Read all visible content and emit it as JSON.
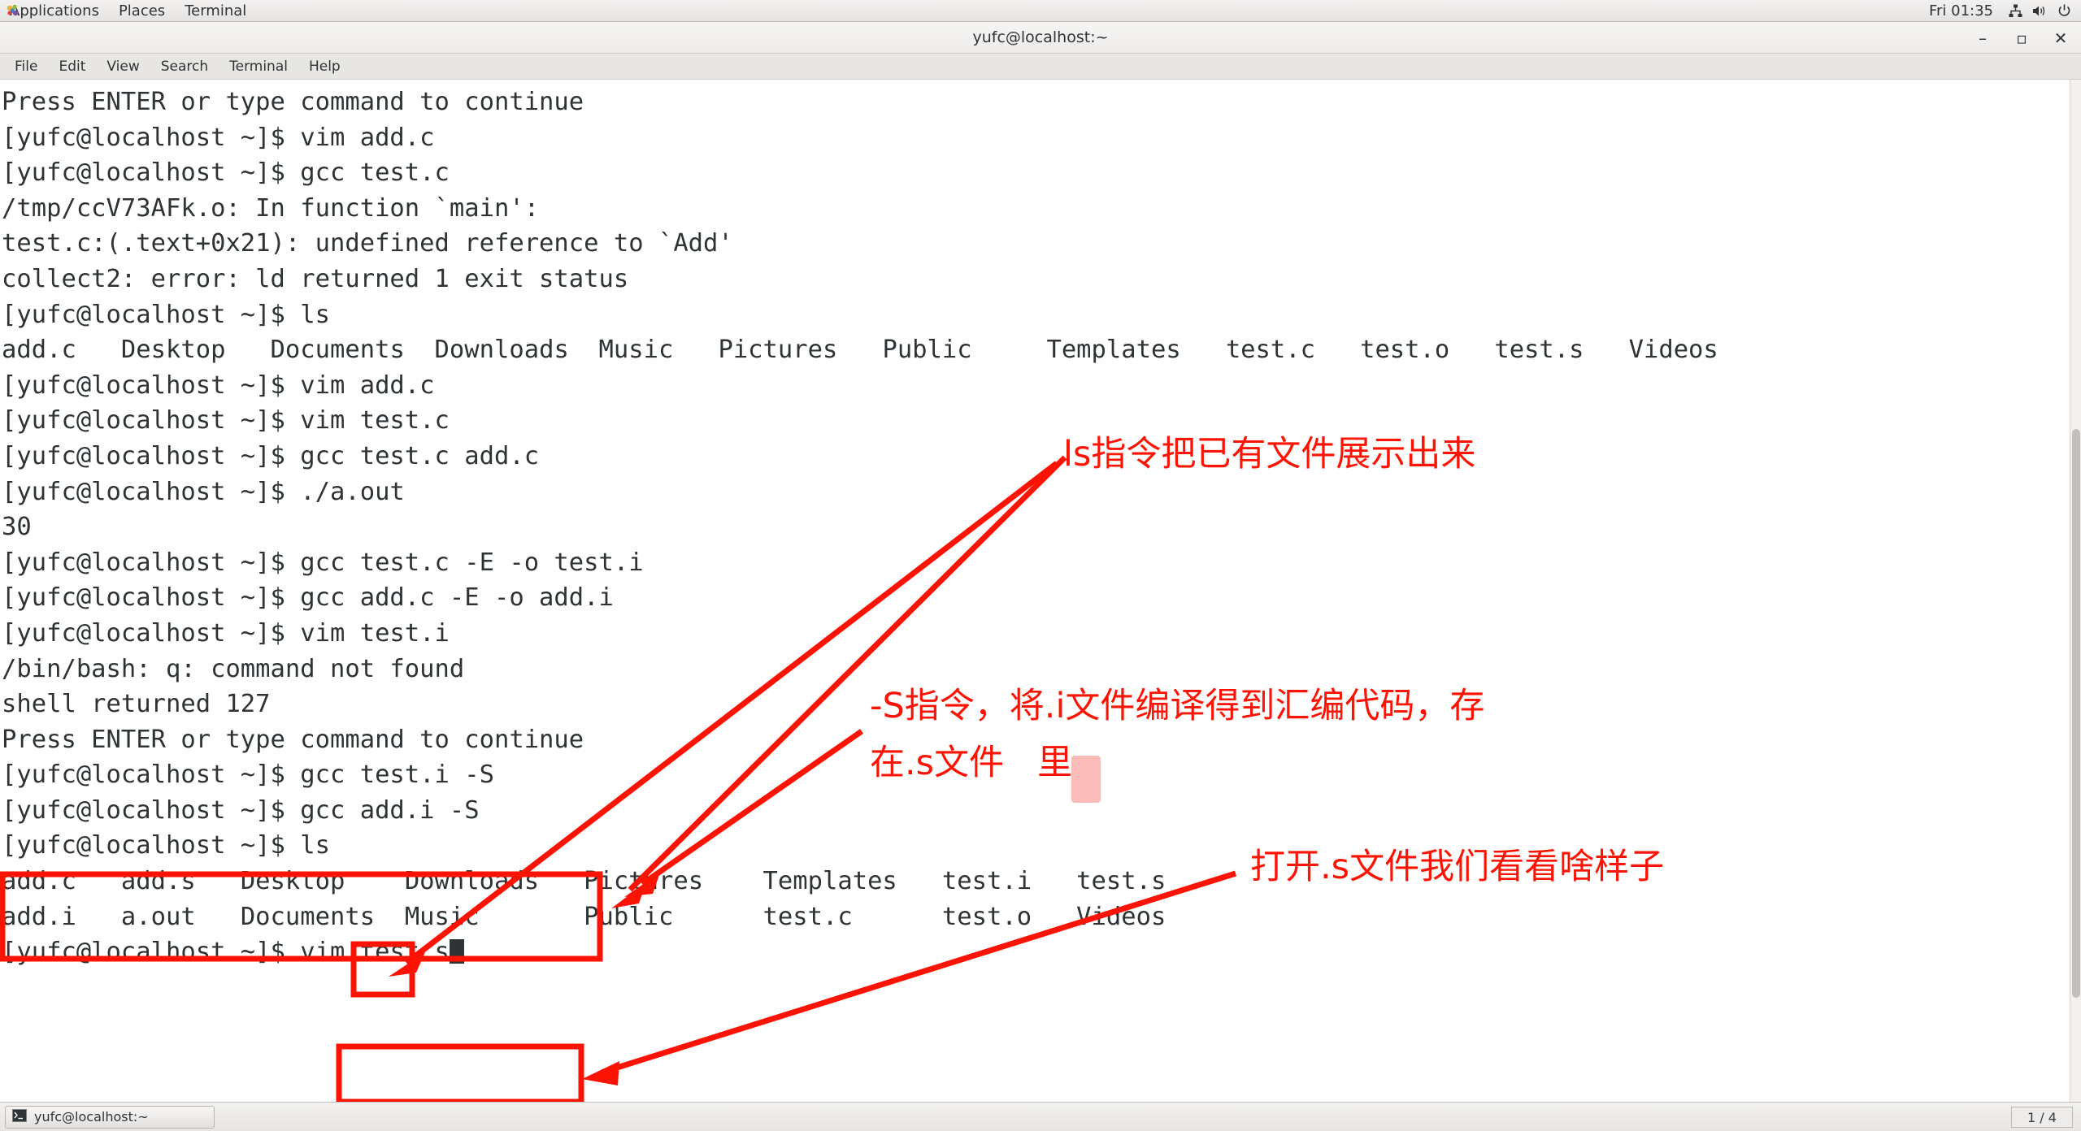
{
  "top_panel": {
    "menus": [
      "Applications",
      "Places",
      "Terminal"
    ],
    "clock": "Fri 01:35",
    "tray": [
      "network-icon",
      "volume-icon",
      "power-icon"
    ],
    "apps_icon": "gnome-footprint-icon"
  },
  "window": {
    "title": "yufc@localhost:~",
    "buttons": {
      "minimize": "–",
      "maximize": "▫",
      "close": "✕"
    },
    "menubar": [
      "File",
      "Edit",
      "View",
      "Search",
      "Terminal",
      "Help"
    ]
  },
  "terminal": {
    "prompt": "[yufc@localhost ~]$ ",
    "lines": [
      {
        "id": "l0",
        "type": "plain",
        "text": "Press ENTER or type command to continue"
      },
      {
        "id": "l1",
        "type": "cmd",
        "text": "vim add.c"
      },
      {
        "id": "l2",
        "type": "cmd",
        "text": "gcc test.c"
      },
      {
        "id": "l3",
        "type": "plain",
        "text": "/tmp/ccV73AFk.o: In function `main':"
      },
      {
        "id": "l4",
        "type": "plain",
        "text": "test.c:(.text+0x21): undefined reference to `Add'"
      },
      {
        "id": "l5",
        "type": "plain",
        "text": "collect2: error: ld returned 1 exit status"
      },
      {
        "id": "l6",
        "type": "cmd",
        "text": "ls"
      },
      {
        "id": "l7",
        "type": "ls1"
      },
      {
        "id": "l8",
        "type": "cmd",
        "text": "vim add.c"
      },
      {
        "id": "l9",
        "type": "cmd",
        "text": "vim test.c"
      },
      {
        "id": "l10",
        "type": "cmd",
        "text": "gcc test.c add.c"
      },
      {
        "id": "l11",
        "type": "cmd",
        "text": "./a.out"
      },
      {
        "id": "l12",
        "type": "plain",
        "text": "30"
      },
      {
        "id": "l13",
        "type": "cmd",
        "text": "gcc test.c -E -o test.i"
      },
      {
        "id": "l14",
        "type": "cmd",
        "text": "gcc add.c -E -o add.i"
      },
      {
        "id": "l15",
        "type": "cmd",
        "text": "vim test.i"
      },
      {
        "id": "l16",
        "type": "plain",
        "text": ""
      },
      {
        "id": "l17",
        "type": "plain",
        "text": "/bin/bash: q: command not found"
      },
      {
        "id": "l18",
        "type": "plain",
        "text": ""
      },
      {
        "id": "l19",
        "type": "plain",
        "text": "shell returned 127"
      },
      {
        "id": "l20",
        "type": "plain",
        "text": ""
      },
      {
        "id": "l21",
        "type": "plain",
        "text": "Press ENTER or type command to continue"
      },
      {
        "id": "l22",
        "type": "cmd",
        "text": "gcc test.i -S"
      },
      {
        "id": "l23",
        "type": "cmd",
        "text": "gcc add.i -S"
      },
      {
        "id": "l24",
        "type": "cmd",
        "text": "ls"
      },
      {
        "id": "l25",
        "type": "ls2a"
      },
      {
        "id": "l26",
        "type": "ls2b"
      },
      {
        "id": "l27",
        "type": "cmd-cursor",
        "text": "vim test.s"
      }
    ],
    "ls_first": [
      {
        "name": "add.c",
        "kind": "file"
      },
      {
        "name": "Desktop",
        "kind": "dir"
      },
      {
        "name": "Documents",
        "kind": "dir"
      },
      {
        "name": "Downloads",
        "kind": "dir"
      },
      {
        "name": "Music",
        "kind": "dir"
      },
      {
        "name": "Pictures",
        "kind": "dir"
      },
      {
        "name": "Public",
        "kind": "dir"
      },
      {
        "name": "Templates",
        "kind": "dir"
      },
      {
        "name": "test.c",
        "kind": "file"
      },
      {
        "name": "test.o",
        "kind": "file"
      },
      {
        "name": "test.s",
        "kind": "file"
      },
      {
        "name": "Videos",
        "kind": "dir"
      }
    ],
    "ls_second_row1": [
      {
        "name": "add.c",
        "kind": "file"
      },
      {
        "name": "add.s",
        "kind": "file"
      },
      {
        "name": "Desktop",
        "kind": "dir"
      },
      {
        "name": "Downloads",
        "kind": "dir"
      },
      {
        "name": "Pictures",
        "kind": "dir"
      },
      {
        "name": "Templates",
        "kind": "dir"
      },
      {
        "name": "test.i",
        "kind": "file"
      },
      {
        "name": "test.s",
        "kind": "file"
      }
    ],
    "ls_second_row2": [
      {
        "name": "add.i",
        "kind": "file"
      },
      {
        "name": "a.out",
        "kind": "exe"
      },
      {
        "name": "Documents",
        "kind": "dir"
      },
      {
        "name": "Music",
        "kind": "dir"
      },
      {
        "name": "Public",
        "kind": "dir"
      },
      {
        "name": "test.c",
        "kind": "file"
      },
      {
        "name": "test.o",
        "kind": "file"
      },
      {
        "name": "Videos",
        "kind": "dir"
      }
    ],
    "colors": {
      "dir": "#2a47f5",
      "executable": "#12b312",
      "text": "#2e3436",
      "background": "#ffffff"
    }
  },
  "annotations": {
    "color": "#fc1303",
    "notes": [
      {
        "id": "a1",
        "text": "ls指令把已有文件展示出来"
      },
      {
        "id": "a2",
        "text": "-S指令，将.i文件编译得到汇编代码，存"
      },
      {
        "id": "a3",
        "text": "在.s文件   里"
      },
      {
        "id": "a4",
        "text": "打开.s文件我们看看啥样子"
      }
    ]
  },
  "taskbar": {
    "window_item": "yufc@localhost:~",
    "window_icon": "terminal-icon",
    "workspace": "1 / 4"
  }
}
